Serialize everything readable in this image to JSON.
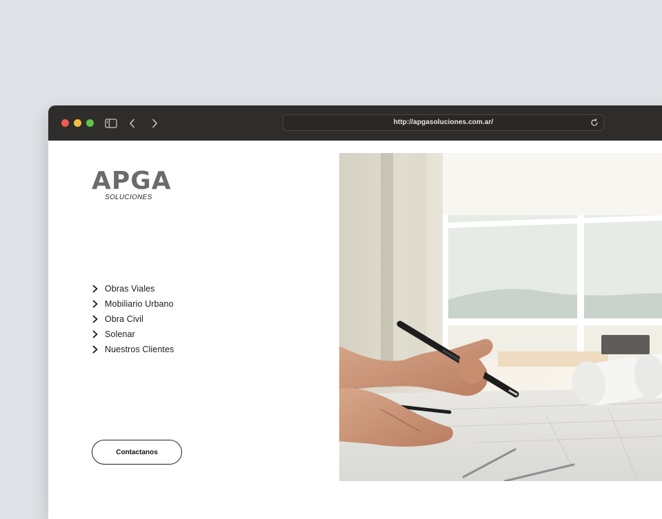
{
  "browser": {
    "url": "http://apgasoluciones.com.ar/",
    "icons": {
      "sidebar": "sidebar-toggle-icon",
      "back": "chevron-left-icon",
      "forward": "chevron-right-icon",
      "reload": "reload-icon"
    }
  },
  "site": {
    "logo": {
      "main": "APGA",
      "sub": "SOLUCIONES"
    },
    "nav": [
      {
        "label": "Obras Viales",
        "icon": "chevron-right-icon"
      },
      {
        "label": "Mobiliario Urbano",
        "icon": "chevron-right-icon"
      },
      {
        "label": "Obra Civil",
        "icon": "chevron-right-icon"
      },
      {
        "label": "Solenar",
        "icon": "chevron-right-icon"
      },
      {
        "label": "Nuestros Clientes",
        "icon": "chevron-right-icon"
      }
    ],
    "contact_button": "Contactanos",
    "hero_image": "photo of hands drawing architectural plans with a pen at a desk near a bright window"
  },
  "colors": {
    "page_bg": "#dfe2e6",
    "titlebar": "#2f2d2b",
    "logo": "#6b6b6b",
    "text": "#1b1b1b"
  }
}
